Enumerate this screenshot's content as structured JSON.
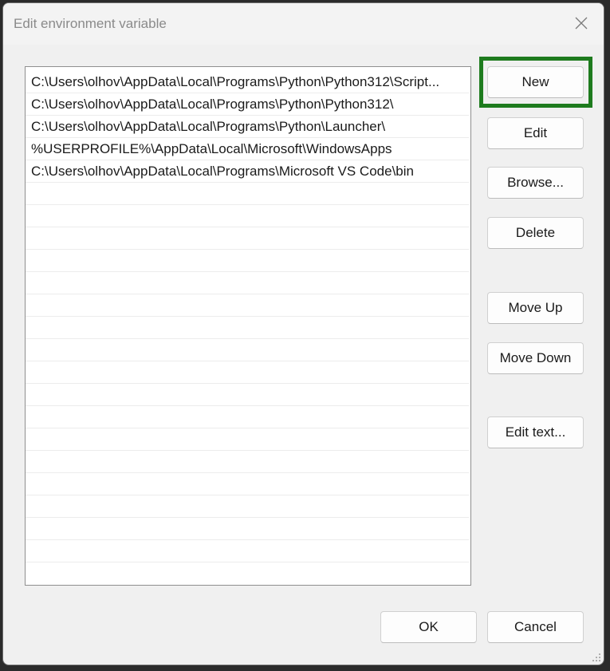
{
  "window": {
    "title": "Edit environment variable",
    "close_icon": "close-icon"
  },
  "paths": [
    "C:\\Users\\olhov\\AppData\\Local\\Programs\\Python\\Python312\\Script...",
    "C:\\Users\\olhov\\AppData\\Local\\Programs\\Python\\Python312\\",
    "C:\\Users\\olhov\\AppData\\Local\\Programs\\Python\\Launcher\\",
    "%USERPROFILE%\\AppData\\Local\\Microsoft\\WindowsApps",
    "C:\\Users\\olhov\\AppData\\Local\\Programs\\Microsoft VS Code\\bin"
  ],
  "buttons": {
    "new": "New",
    "edit": "Edit",
    "browse": "Browse...",
    "delete": "Delete",
    "move_up": "Move Up",
    "move_down": "Move Down",
    "edit_text": "Edit text...",
    "ok": "OK",
    "cancel": "Cancel"
  },
  "highlight_color": "#1e7b1e"
}
